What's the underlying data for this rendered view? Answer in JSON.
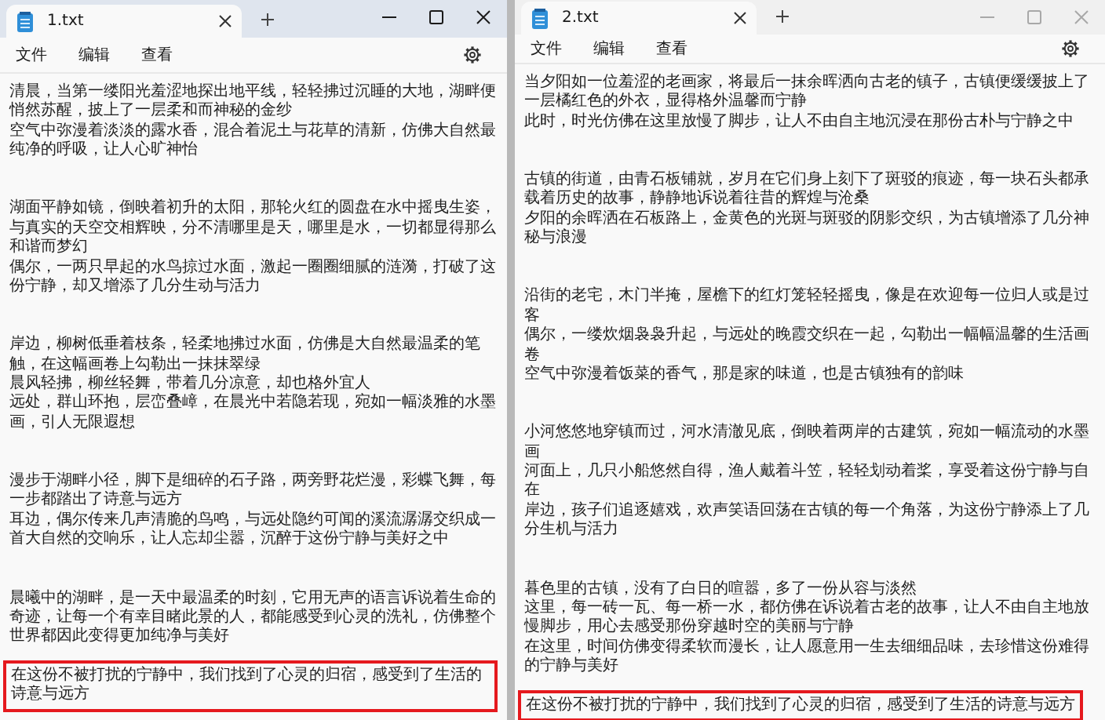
{
  "windows": [
    {
      "active": true,
      "tab": {
        "title": "1.txt",
        "selected": true
      },
      "menu": [
        "文件",
        "编辑",
        "查看"
      ],
      "paragraphs": [
        {
          "highlighted": false,
          "lines": [
            "清晨，当第一缕阳光羞涩地探出地平线，轻轻拂过沉睡的大地，湖畔便悄然苏醒，披上了一层柔和而神秘的金纱",
            "空气中弥漫着淡淡的露水香，混合着泥土与花草的清新，仿佛大自然最纯净的呼吸，让人心旷神怡"
          ]
        },
        {
          "highlighted": false,
          "lines": [
            "湖面平静如镜，倒映着初升的太阳，那轮火红的圆盘在水中摇曳生姿，与真实的天空交相辉映，分不清哪里是天，哪里是水，一切都显得那么和谐而梦幻",
            "偶尔，一两只早起的水鸟掠过水面，激起一圈圈细腻的涟漪，打破了这份宁静，却又增添了几分生动与活力"
          ]
        },
        {
          "highlighted": false,
          "lines": [
            "岸边，柳树低垂着枝条，轻柔地拂过水面，仿佛是大自然最温柔的笔触，在这幅画卷上勾勒出一抹抹翠绿",
            "晨风轻拂，柳丝轻舞，带着几分凉意，却也格外宜人",
            "远处，群山环抱，层峦叠嶂，在晨光中若隐若现，宛如一幅淡雅的水墨画，引人无限遐想"
          ]
        },
        {
          "highlighted": false,
          "lines": [
            "漫步于湖畔小径，脚下是细碎的石子路，两旁野花烂漫，彩蝶飞舞，每一步都踏出了诗意与远方",
            "耳边，偶尔传来几声清脆的鸟鸣，与远处隐约可闻的溪流潺潺交织成一首大自然的交响乐，让人忘却尘嚣，沉醉于这份宁静与美好之中"
          ]
        },
        {
          "highlighted": false,
          "lines": [
            "晨曦中的湖畔，是一天中最温柔的时刻，它用无声的语言诉说着生命的奇迹，让每一个有幸目睹此景的人，都能感受到心灵的洗礼，仿佛整个世界都因此变得更加纯净与美好"
          ]
        },
        {
          "highlighted": true,
          "lines": [
            "在这份不被打扰的宁静中，我们找到了心灵的归宿，感受到了生活的诗意与远方"
          ]
        }
      ]
    },
    {
      "active": false,
      "tab": {
        "title": "2.txt",
        "selected": true
      },
      "menu": [
        "文件",
        "编辑",
        "查看"
      ],
      "paragraphs": [
        {
          "highlighted": false,
          "lines": [
            "当夕阳如一位羞涩的老画家，将最后一抹余晖洒向古老的镇子，古镇便缓缓披上了一层橘红色的外衣，显得格外温馨而宁静",
            "此时，时光仿佛在这里放慢了脚步，让人不由自主地沉浸在那份古朴与宁静之中"
          ]
        },
        {
          "highlighted": false,
          "lines": [
            "古镇的街道，由青石板铺就，岁月在它们身上刻下了斑驳的痕迹，每一块石头都承载着历史的故事，静静地诉说着往昔的辉煌与沧桑",
            "夕阳的余晖洒在石板路上，金黄色的光斑与斑驳的阴影交织，为古镇增添了几分神秘与浪漫"
          ]
        },
        {
          "highlighted": false,
          "lines": [
            "沿街的老宅，木门半掩，屋檐下的红灯笼轻轻摇曳，像是在欢迎每一位归人或是过客",
            "偶尔，一缕炊烟袅袅升起，与远处的晚霞交织在一起，勾勒出一幅幅温馨的生活画卷",
            "空气中弥漫着饭菜的香气，那是家的味道，也是古镇独有的韵味"
          ]
        },
        {
          "highlighted": false,
          "lines": [
            "小河悠悠地穿镇而过，河水清澈见底，倒映着两岸的古建筑，宛如一幅流动的水墨画",
            "河面上，几只小船悠然自得，渔人戴着斗笠，轻轻划动着桨，享受着这份宁静与自在",
            "岸边，孩子们追逐嬉戏，欢声笑语回荡在古镇的每一个角落，为这份宁静添上了几分生机与活力"
          ]
        },
        {
          "highlighted": false,
          "lines": [
            "暮色里的古镇，没有了白日的喧嚣，多了一份从容与淡然",
            "这里，每一砖一瓦、每一桥一水，都仿佛在诉说着古老的故事，让人不由自主地放慢脚步，用心去感受那份穿越时空的美丽与宁静",
            "在这里，时间仿佛变得柔软而漫长，让人愿意用一生去细细品味，去珍惜这份难得的宁静与美好"
          ]
        },
        {
          "highlighted": true,
          "lines": [
            "在这份不被打扰的宁静中，我们找到了心灵的归宿，感受到了生活的诗意与远方"
          ]
        }
      ]
    }
  ]
}
